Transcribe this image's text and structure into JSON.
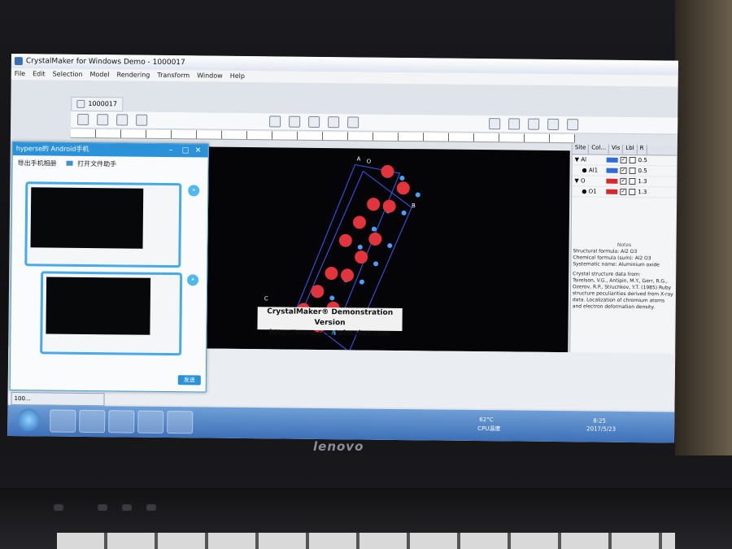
{
  "window": {
    "title": "CrystalMaker for Windows Demo - 1000017",
    "doc_tab": "1000017"
  },
  "menu": [
    "File",
    "Edit",
    "Selection",
    "Model",
    "Rendering",
    "Transform",
    "Window",
    "Help"
  ],
  "viewport": {
    "banner_line1": "CrystalMaker® Demonstration Version",
    "banner_line2": "http://www.crystalmaker.com",
    "axis_labels": [
      "A",
      "O",
      "B",
      "C"
    ]
  },
  "sites_panel": {
    "headers": [
      "Site",
      "Col...",
      "Vis",
      "Lbl",
      "R"
    ],
    "rows": [
      {
        "name": "Al",
        "group": true,
        "color": "#2f6bd8",
        "visible": true,
        "r": "0.5"
      },
      {
        "name": "Al1",
        "group": false,
        "color": "#2f6bd8",
        "visible": true,
        "r": "0.5"
      },
      {
        "name": "O",
        "group": true,
        "color": "#d8282c",
        "visible": true,
        "r": "1.3"
      },
      {
        "name": "O1",
        "group": false,
        "color": "#d8282c",
        "visible": true,
        "r": "1.3"
      }
    ],
    "notes_title": "Notes",
    "notes": [
      "Structural formula: Al2 O3",
      "Chemical formula (sum): Al2 O3",
      "Systematic name: Aluminium oxide",
      "Crystal structure data from:",
      "Tsirelson, V.G., Antipin, M.Y., Gerr, R.G., Ozerov, R.P., Struchkov, Y.T. (1985) Ruby structure peculiarities derived from X-ray data. Localization of chromium atoms and electron deformation density."
    ]
  },
  "chat_window": {
    "title": "hyperse的 Android手机",
    "action_export": "导出手机相册",
    "action_open": "打开文件助手",
    "send_label": "发送"
  },
  "taskbar": {
    "quick_launch_text": "100...",
    "temperature": "62°C",
    "cpu_label": "CPU温度",
    "clock_time": "8:25",
    "clock_date": "2017/5/23"
  },
  "device": {
    "brand": "lenovo"
  }
}
